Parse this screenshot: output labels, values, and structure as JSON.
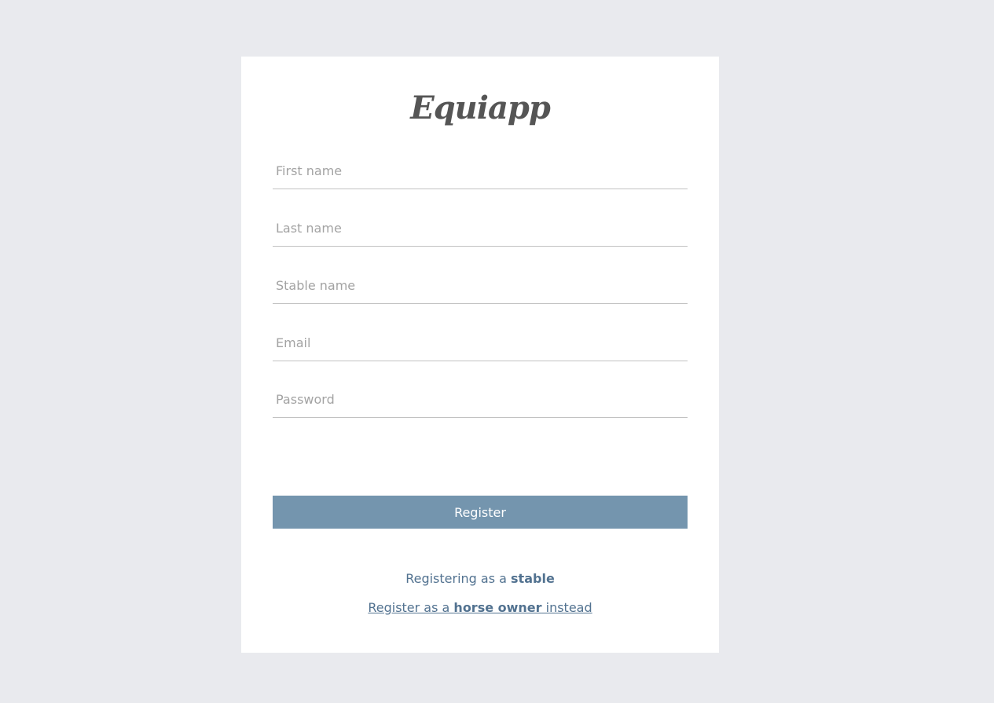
{
  "app": {
    "logo_text": "Equiapp"
  },
  "form": {
    "fields": [
      {
        "placeholder": "First name",
        "value": ""
      },
      {
        "placeholder": "Last name",
        "value": ""
      },
      {
        "placeholder": "Stable name",
        "value": ""
      },
      {
        "placeholder": "Email",
        "value": ""
      },
      {
        "placeholder": "Password",
        "value": ""
      }
    ],
    "submit_label": "Register"
  },
  "role": {
    "prefix": "Registering as a ",
    "current": "stable"
  },
  "switch": {
    "prefix": "Register as a ",
    "target": "horse owner",
    "suffix": " instead"
  },
  "colors": {
    "background": "#e9eaee",
    "card": "#ffffff",
    "accent": "#7495ae",
    "link": "#527290"
  }
}
